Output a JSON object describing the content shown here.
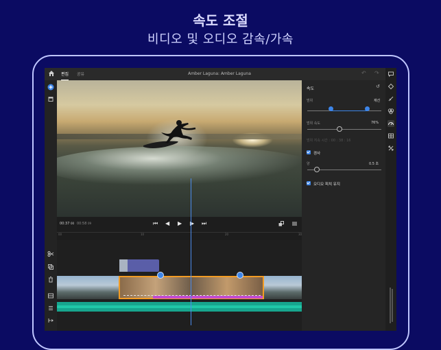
{
  "banner": {
    "title": "속도 조절",
    "subtitle": "비디오 및 오디오 감속/가속"
  },
  "header": {
    "tabs": [
      {
        "label": "편집",
        "active": true
      },
      {
        "label": "공유",
        "active": false
      }
    ],
    "doc_title": "Amber Laguna: Amber Laguna"
  },
  "transport": {
    "current_time": "00:37",
    "current_frames": "00",
    "total_time": "00:58",
    "total_frames": "09"
  },
  "ruler": {
    "marks": [
      "00",
      "10",
      "20",
      "30"
    ]
  },
  "speed_panel": {
    "title": "속도",
    "range_label": "범위",
    "range_action": "재선",
    "range_speed_label": "범위 속도",
    "range_speed_value": "76%",
    "range_speed_level": 0.43,
    "duration_label": "범위 지속 시간 :",
    "duration_value": "00 : 38 : 16",
    "ramp": {
      "label": "경사",
      "checked": true
    },
    "amount_label": "양",
    "amount_value": "0.5 초",
    "amount_level": 0.12,
    "pitch": {
      "label": "오디오 피치 유지",
      "checked": true
    }
  },
  "colors": {
    "background": "#0b0b62",
    "accent": "#3d85e8",
    "clip_selected": "#f39c24",
    "speed_range": "#c34bd1",
    "audio": "#17a58e"
  }
}
